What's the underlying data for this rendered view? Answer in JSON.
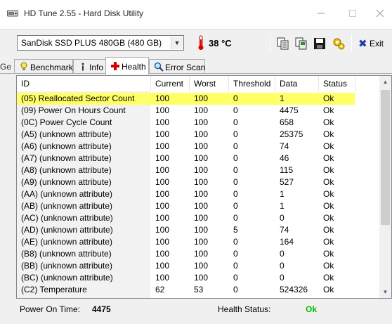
{
  "window": {
    "title": "HD Tune 2.55 - Hard Disk Utility"
  },
  "toolbar": {
    "drive": "SanDisk SSD PLUS 480GB (480 GB)",
    "temperature": "38 °C",
    "exit_label": "Exit"
  },
  "tabs": [
    {
      "label": "Benchmark",
      "icon": "lightbulb-icon"
    },
    {
      "label": "Info",
      "icon": "info-icon"
    },
    {
      "label": "Health",
      "icon": "health-cross-icon",
      "active": true
    },
    {
      "label": "Error Scan",
      "icon": "magnifier-icon"
    }
  ],
  "left_stub": "Ge",
  "table": {
    "columns": [
      "ID",
      "Current",
      "Worst",
      "Threshold",
      "Data",
      "Status"
    ],
    "rows": [
      [
        "(05) Reallocated Sector Count",
        "100",
        "100",
        "0",
        "1",
        "Ok"
      ],
      [
        "(09) Power On Hours Count",
        "100",
        "100",
        "0",
        "4475",
        "Ok"
      ],
      [
        "(0C) Power Cycle Count",
        "100",
        "100",
        "0",
        "658",
        "Ok"
      ],
      [
        "(A5) (unknown attribute)",
        "100",
        "100",
        "0",
        "25375",
        "Ok"
      ],
      [
        "(A6) (unknown attribute)",
        "100",
        "100",
        "0",
        "74",
        "Ok"
      ],
      [
        "(A7) (unknown attribute)",
        "100",
        "100",
        "0",
        "46",
        "Ok"
      ],
      [
        "(A8) (unknown attribute)",
        "100",
        "100",
        "0",
        "115",
        "Ok"
      ],
      [
        "(A9) (unknown attribute)",
        "100",
        "100",
        "0",
        "527",
        "Ok"
      ],
      [
        "(AA) (unknown attribute)",
        "100",
        "100",
        "0",
        "1",
        "Ok"
      ],
      [
        "(AB) (unknown attribute)",
        "100",
        "100",
        "0",
        "1",
        "Ok"
      ],
      [
        "(AC) (unknown attribute)",
        "100",
        "100",
        "0",
        "0",
        "Ok"
      ],
      [
        "(AD) (unknown attribute)",
        "100",
        "100",
        "5",
        "74",
        "Ok"
      ],
      [
        "(AE) (unknown attribute)",
        "100",
        "100",
        "0",
        "164",
        "Ok"
      ],
      [
        "(B8) (unknown attribute)",
        "100",
        "100",
        "0",
        "0",
        "Ok"
      ],
      [
        "(BB) (unknown attribute)",
        "100",
        "100",
        "0",
        "0",
        "Ok"
      ],
      [
        "(BC) (unknown attribute)",
        "100",
        "100",
        "0",
        "0",
        "Ok"
      ],
      [
        "(C2) Temperature",
        "62",
        "53",
        "0",
        "524326",
        "Ok"
      ]
    ],
    "selected_row": 0
  },
  "footer": {
    "power_on_label": "Power On Time:",
    "power_on_value": "4475",
    "health_label": "Health Status:",
    "health_value": "Ok"
  },
  "colors": {
    "selection": "#ffff66",
    "ok": "#00c000"
  }
}
